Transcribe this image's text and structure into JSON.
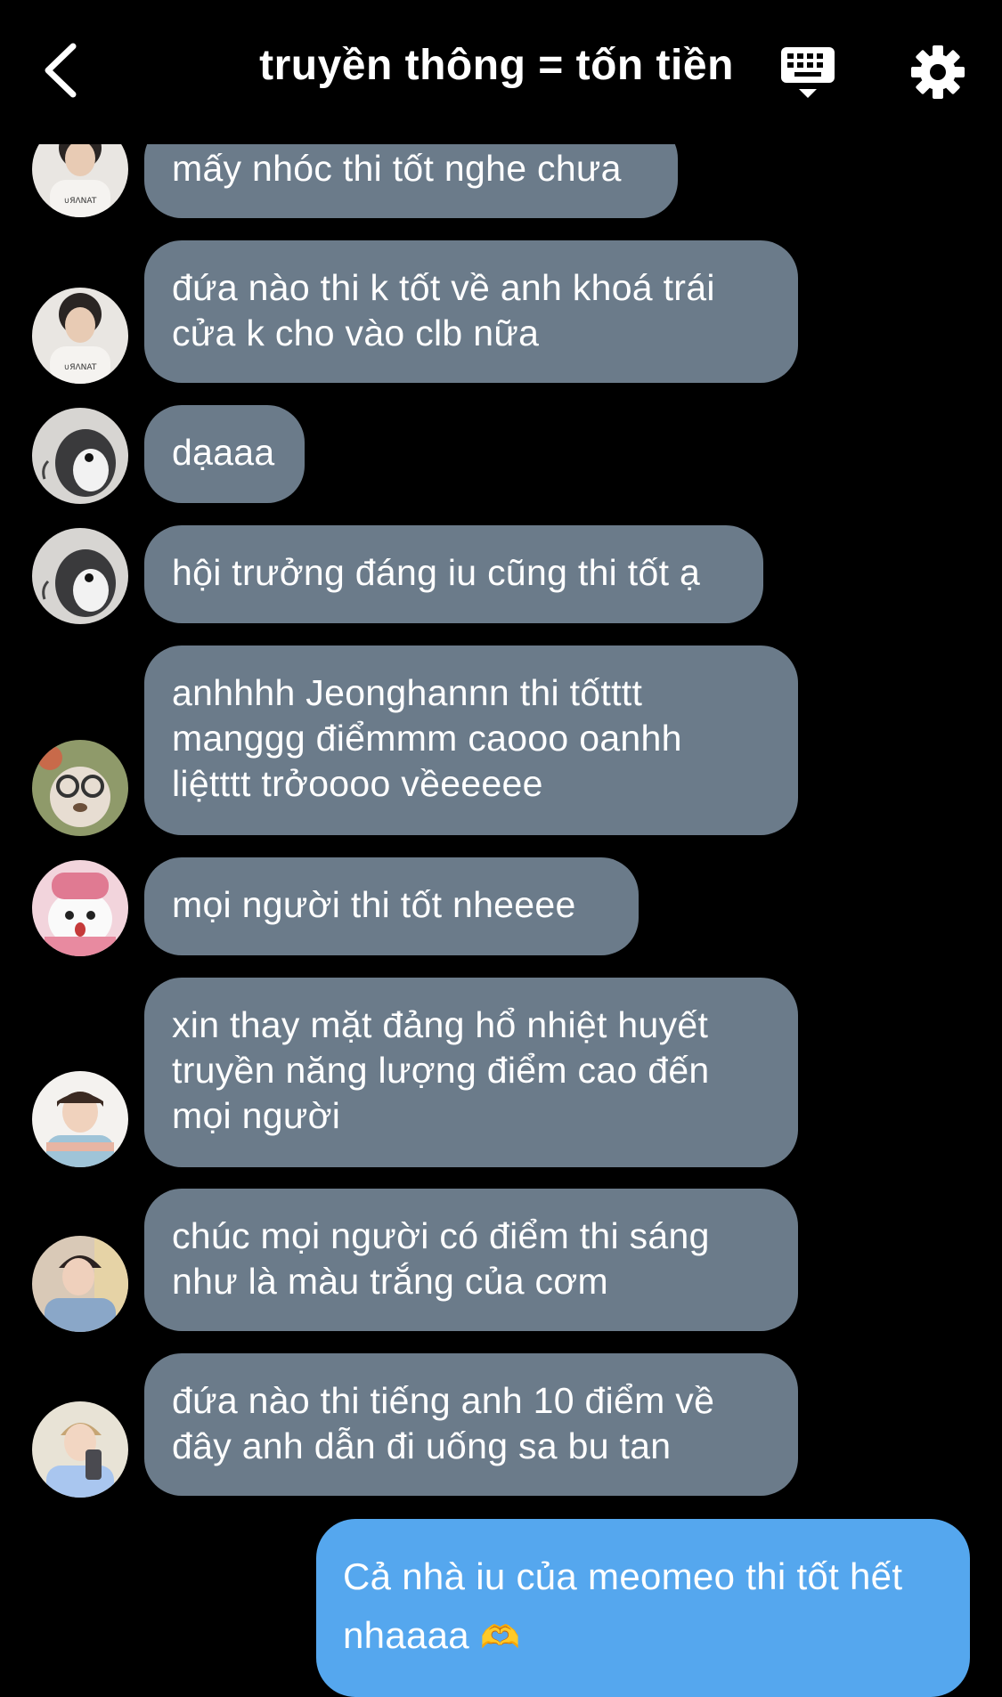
{
  "header": {
    "title": "truyền thông = tốn tiền",
    "back_icon": "chevron-left-icon",
    "keyboard_icon": "keyboard-dismiss-icon",
    "settings_icon": "gear-icon"
  },
  "colors": {
    "background": "#000000",
    "bubble_other": "#6b7b8a",
    "bubble_me": "#55a7ee",
    "text": "#ffffff"
  },
  "messages": [
    {
      "lines": [
        "mấy nhóc thi tốt nghe chưa"
      ]
    },
    {
      "lines": [
        "đứa nào thi k tốt về anh khoá trái",
        "cửa k cho vào clb nữa"
      ]
    },
    {
      "lines": [
        "dạaaa"
      ]
    },
    {
      "lines": [
        "hội trưởng đáng iu cũng thi tốt ạ"
      ]
    },
    {
      "lines": [
        "anhhhh Jeonghannn thi tốtttt",
        "manggg điểmmm caooo oanhh",
        "liệtttt trởoooo vềeeeee"
      ]
    },
    {
      "lines": [
        "mọi người thi tốt nheeee"
      ]
    },
    {
      "lines": [
        "xin thay mặt đảng hổ nhiệt huyết",
        "truyền năng lượng điểm cao đến",
        "mọi người"
      ]
    },
    {
      "lines": [
        "chúc mọi người có điểm thi sáng",
        "như là màu trắng của cơm"
      ]
    },
    {
      "lines": [
        "đứa nào thi tiếng anh 10 điểm về",
        "đây anh dẫn đi uống sa bu tan"
      ]
    }
  ],
  "my_message": {
    "lines": [
      "Cả nhà iu của meomeo thi tốt hết",
      "nhaaaa"
    ],
    "emoji": "🫶"
  }
}
